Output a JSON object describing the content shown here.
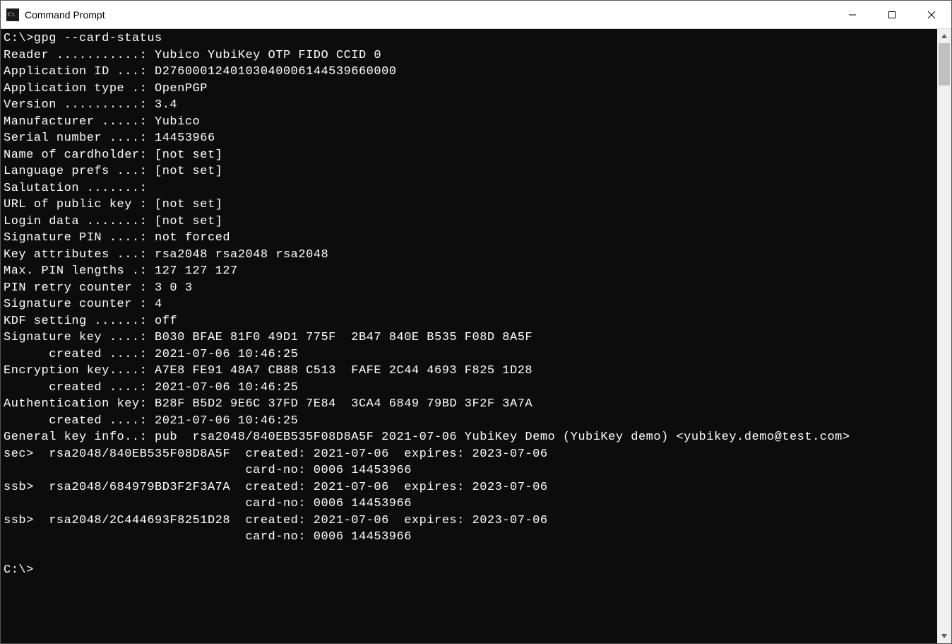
{
  "window": {
    "title": "Command Prompt"
  },
  "terminal": {
    "prompt1": "C:\\>gpg --card-status",
    "lines": {
      "reader": "Reader ...........: Yubico YubiKey OTP FIDO CCID 0",
      "app_id": "Application ID ...: D2760001240103040006144539660000",
      "app_type": "Application type .: OpenPGP",
      "version": "Version ..........: 3.4",
      "manufacturer": "Manufacturer .....: Yubico",
      "serial": "Serial number ....: 14453966",
      "cardholder": "Name of cardholder: [not set]",
      "lang": "Language prefs ...: [not set]",
      "salutation": "Salutation .......:",
      "url": "URL of public key : [not set]",
      "login": "Login data .......: [not set]",
      "sig_pin": "Signature PIN ....: not forced",
      "key_attr": "Key attributes ...: rsa2048 rsa2048 rsa2048",
      "max_pin": "Max. PIN lengths .: 127 127 127",
      "pin_retry": "PIN retry counter : 3 0 3",
      "sig_counter": "Signature counter : 4",
      "kdf": "KDF setting ......: off",
      "sig_key": "Signature key ....: B030 BFAE 81F0 49D1 775F  2B47 840E B535 F08D 8A5F",
      "sig_created": "      created ....: 2021-07-06 10:46:25",
      "enc_key": "Encryption key....: A7E8 FE91 48A7 CB88 C513  FAFE 2C44 4693 F825 1D28",
      "enc_created": "      created ....: 2021-07-06 10:46:25",
      "auth_key": "Authentication key: B28F B5D2 9E6C 37FD 7E84  3CA4 6849 79BD 3F2F 3A7A",
      "auth_created": "      created ....: 2021-07-06 10:46:25",
      "gen_info": "General key info..: pub  rsa2048/840EB535F08D8A5F 2021-07-06 YubiKey Demo (YubiKey demo) <yubikey.demo@test.com>",
      "sec": "sec>  rsa2048/840EB535F08D8A5F  created: 2021-07-06  expires: 2023-07-06",
      "sec_card": "                                card-no: 0006 14453966",
      "ssb1": "ssb>  rsa2048/684979BD3F2F3A7A  created: 2021-07-06  expires: 2023-07-06",
      "ssb1_card": "                                card-no: 0006 14453966",
      "ssb2": "ssb>  rsa2048/2C444693F8251D28  created: 2021-07-06  expires: 2023-07-06",
      "ssb2_card": "                                card-no: 0006 14453966"
    },
    "prompt2": "C:\\>"
  }
}
